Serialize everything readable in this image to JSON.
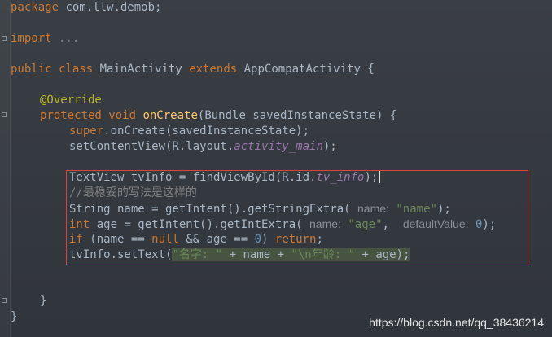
{
  "code": {
    "line_package": {
      "kw": "package",
      "rest": " com.llw.demob;"
    },
    "line_import": {
      "kw": "import",
      "rest": " ..."
    },
    "line_class": {
      "public": "public",
      "class": "class",
      "name": " MainActivity ",
      "extends": "extends",
      "rest": " AppCompatActivity {"
    },
    "line_override": "@Override",
    "line_oncreate": {
      "protected": "protected",
      "void": "void",
      "name": "onCreate",
      "rest": "(Bundle savedInstanceState) {"
    },
    "line_super": {
      "super": "super",
      "rest": ".onCreate(savedInstanceState);"
    },
    "line_setcontent": {
      "pre": "setContentView(R.layout.",
      "field": "activity_main",
      "post": ");"
    },
    "line_textview": {
      "pre": "TextView tvInfo = findViewById(R.id.",
      "field": "tv_info",
      "post": ");"
    },
    "line_comment": "//最稳妥的写法是这样的",
    "line_string": {
      "pre": "String name = getIntent().getStringExtra( ",
      "hint": "name:",
      "str": "\"name\"",
      "post": ");"
    },
    "line_int": {
      "kw": "int",
      "mid": " age = getIntent().getIntExtra( ",
      "hint1": "name:",
      "str": "\"age\"",
      "comma": ",  ",
      "hint2": "defaultValue:",
      "num": "0",
      "post": ");"
    },
    "line_if": {
      "kw": "if",
      "a": " (name == ",
      "null": "null",
      "b": " && age == ",
      "num": "0",
      "c": ") ",
      "ret": "return",
      "d": ";"
    },
    "line_settext": {
      "pre": "tvInfo.setText(",
      "s1": "\"名字: \"",
      "mid": " + name + ",
      "s2": "\"\\n年龄: \"",
      "post": " + age);"
    },
    "line_close_method": "}",
    "line_close_class": "}"
  },
  "watermark": "https://blog.csdn.net/qq_38436214"
}
